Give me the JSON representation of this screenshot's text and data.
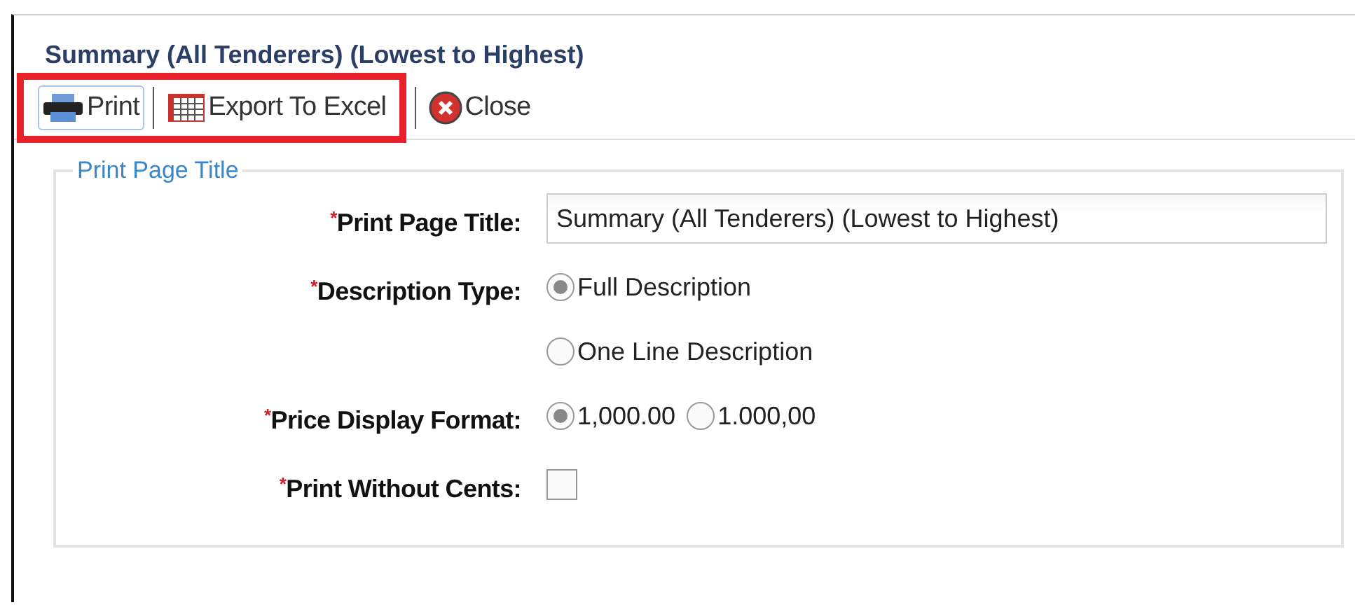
{
  "window": {
    "title": "Summary (All Tenderers) (Lowest to Highest)"
  },
  "toolbar": [
    {
      "kind": "print",
      "label": "Print",
      "focused": true,
      "highlighted": true
    },
    {
      "kind": "excel",
      "label": "Export To Excel",
      "focused": false,
      "highlighted": true
    },
    {
      "kind": "close",
      "label": "Close",
      "focused": false,
      "highlighted": false
    }
  ],
  "fieldset": {
    "legend": "Print Page Title",
    "rows": [
      {
        "kind": "text",
        "marker": "*",
        "label": "Print Page Title:",
        "value": "Summary (All Tenderers) (Lowest to Highest)"
      },
      {
        "kind": "radio",
        "marker": "*",
        "label": "Description Type:",
        "stacked": true,
        "options": [
          {
            "label": "Full Description",
            "selected": true
          },
          {
            "label": "One Line Description",
            "selected": false
          }
        ]
      },
      {
        "kind": "radio",
        "marker": "*",
        "label": "Price Display Format:",
        "stacked": false,
        "options": [
          {
            "label": "1,000.00",
            "selected": true
          },
          {
            "label": "1.000,00",
            "selected": false
          }
        ]
      },
      {
        "kind": "checkbox",
        "marker": "*",
        "label": "Print Without Cents:",
        "checked": false
      }
    ]
  }
}
